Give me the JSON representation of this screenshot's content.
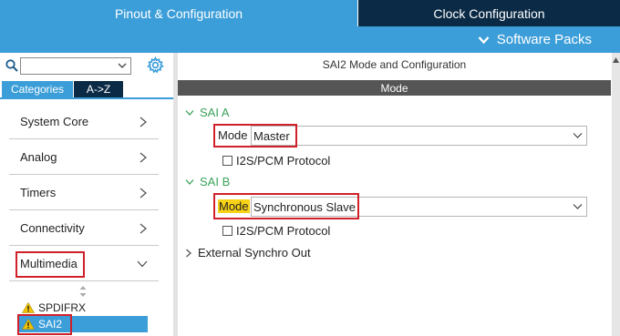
{
  "tabs": {
    "pinout": "Pinout & Configuration",
    "clock": "Clock Configuration"
  },
  "software_packs": {
    "label": "Software Packs",
    "icon": "chevron-down-icon"
  },
  "search": {
    "value": "",
    "icon": "search-icon",
    "settings_icon": "gear-icon"
  },
  "left_tabs": {
    "categories": "Categories",
    "az": "A->Z"
  },
  "categories": [
    {
      "label": "System Core",
      "icon": "chevron-right-icon"
    },
    {
      "label": "Analog",
      "icon": "chevron-right-icon"
    },
    {
      "label": "Timers",
      "icon": "chevron-right-icon"
    },
    {
      "label": "Connectivity",
      "icon": "chevron-right-icon"
    },
    {
      "label": "Multimedia",
      "icon": "chevron-down-icon",
      "expanded": true
    }
  ],
  "multimedia_items": [
    {
      "label": "SPDIFRX",
      "status_icon": "warning-icon",
      "selected": false
    },
    {
      "label": "SAI2",
      "status_icon": "warning-icon",
      "selected": true
    }
  ],
  "panel": {
    "title": "SAI2 Mode and Configuration",
    "section_header": "Mode",
    "sai_a": {
      "label": "SAI A",
      "mode_label": "Mode",
      "mode_value": "Master",
      "protocol_label": "I2S/PCM Protocol",
      "protocol_checked": false
    },
    "sai_b": {
      "label": "SAI B",
      "mode_label": "Mode",
      "mode_value": "Synchronous Slave",
      "protocol_label": "I2S/PCM Protocol",
      "protocol_checked": false
    },
    "external_sync": {
      "label": "External Synchro Out",
      "expanded": false
    }
  },
  "colors": {
    "accent_blue": "#3c9ed9",
    "dark_navy": "#0a2a45",
    "header_gray": "#555555",
    "section_green": "#3aa35a",
    "highlight_red": "#d0202a",
    "warning_yellow": "#f2c200",
    "mode_highlight": "#f7d217"
  }
}
